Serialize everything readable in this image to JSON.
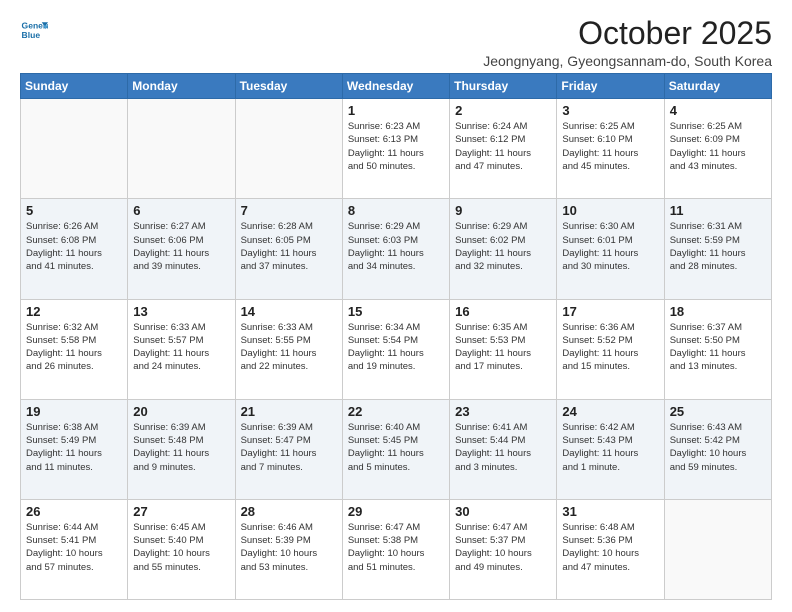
{
  "logo": {
    "line1": "General",
    "line2": "Blue"
  },
  "title": "October 2025",
  "subtitle": "Jeongnyang, Gyeongsannam-do, South Korea",
  "weekdays": [
    "Sunday",
    "Monday",
    "Tuesday",
    "Wednesday",
    "Thursday",
    "Friday",
    "Saturday"
  ],
  "weeks": [
    [
      {
        "day": "",
        "info": ""
      },
      {
        "day": "",
        "info": ""
      },
      {
        "day": "",
        "info": ""
      },
      {
        "day": "1",
        "info": "Sunrise: 6:23 AM\nSunset: 6:13 PM\nDaylight: 11 hours\nand 50 minutes."
      },
      {
        "day": "2",
        "info": "Sunrise: 6:24 AM\nSunset: 6:12 PM\nDaylight: 11 hours\nand 47 minutes."
      },
      {
        "day": "3",
        "info": "Sunrise: 6:25 AM\nSunset: 6:10 PM\nDaylight: 11 hours\nand 45 minutes."
      },
      {
        "day": "4",
        "info": "Sunrise: 6:25 AM\nSunset: 6:09 PM\nDaylight: 11 hours\nand 43 minutes."
      }
    ],
    [
      {
        "day": "5",
        "info": "Sunrise: 6:26 AM\nSunset: 6:08 PM\nDaylight: 11 hours\nand 41 minutes."
      },
      {
        "day": "6",
        "info": "Sunrise: 6:27 AM\nSunset: 6:06 PM\nDaylight: 11 hours\nand 39 minutes."
      },
      {
        "day": "7",
        "info": "Sunrise: 6:28 AM\nSunset: 6:05 PM\nDaylight: 11 hours\nand 37 minutes."
      },
      {
        "day": "8",
        "info": "Sunrise: 6:29 AM\nSunset: 6:03 PM\nDaylight: 11 hours\nand 34 minutes."
      },
      {
        "day": "9",
        "info": "Sunrise: 6:29 AM\nSunset: 6:02 PM\nDaylight: 11 hours\nand 32 minutes."
      },
      {
        "day": "10",
        "info": "Sunrise: 6:30 AM\nSunset: 6:01 PM\nDaylight: 11 hours\nand 30 minutes."
      },
      {
        "day": "11",
        "info": "Sunrise: 6:31 AM\nSunset: 5:59 PM\nDaylight: 11 hours\nand 28 minutes."
      }
    ],
    [
      {
        "day": "12",
        "info": "Sunrise: 6:32 AM\nSunset: 5:58 PM\nDaylight: 11 hours\nand 26 minutes."
      },
      {
        "day": "13",
        "info": "Sunrise: 6:33 AM\nSunset: 5:57 PM\nDaylight: 11 hours\nand 24 minutes."
      },
      {
        "day": "14",
        "info": "Sunrise: 6:33 AM\nSunset: 5:55 PM\nDaylight: 11 hours\nand 22 minutes."
      },
      {
        "day": "15",
        "info": "Sunrise: 6:34 AM\nSunset: 5:54 PM\nDaylight: 11 hours\nand 19 minutes."
      },
      {
        "day": "16",
        "info": "Sunrise: 6:35 AM\nSunset: 5:53 PM\nDaylight: 11 hours\nand 17 minutes."
      },
      {
        "day": "17",
        "info": "Sunrise: 6:36 AM\nSunset: 5:52 PM\nDaylight: 11 hours\nand 15 minutes."
      },
      {
        "day": "18",
        "info": "Sunrise: 6:37 AM\nSunset: 5:50 PM\nDaylight: 11 hours\nand 13 minutes."
      }
    ],
    [
      {
        "day": "19",
        "info": "Sunrise: 6:38 AM\nSunset: 5:49 PM\nDaylight: 11 hours\nand 11 minutes."
      },
      {
        "day": "20",
        "info": "Sunrise: 6:39 AM\nSunset: 5:48 PM\nDaylight: 11 hours\nand 9 minutes."
      },
      {
        "day": "21",
        "info": "Sunrise: 6:39 AM\nSunset: 5:47 PM\nDaylight: 11 hours\nand 7 minutes."
      },
      {
        "day": "22",
        "info": "Sunrise: 6:40 AM\nSunset: 5:45 PM\nDaylight: 11 hours\nand 5 minutes."
      },
      {
        "day": "23",
        "info": "Sunrise: 6:41 AM\nSunset: 5:44 PM\nDaylight: 11 hours\nand 3 minutes."
      },
      {
        "day": "24",
        "info": "Sunrise: 6:42 AM\nSunset: 5:43 PM\nDaylight: 11 hours\nand 1 minute."
      },
      {
        "day": "25",
        "info": "Sunrise: 6:43 AM\nSunset: 5:42 PM\nDaylight: 10 hours\nand 59 minutes."
      }
    ],
    [
      {
        "day": "26",
        "info": "Sunrise: 6:44 AM\nSunset: 5:41 PM\nDaylight: 10 hours\nand 57 minutes."
      },
      {
        "day": "27",
        "info": "Sunrise: 6:45 AM\nSunset: 5:40 PM\nDaylight: 10 hours\nand 55 minutes."
      },
      {
        "day": "28",
        "info": "Sunrise: 6:46 AM\nSunset: 5:39 PM\nDaylight: 10 hours\nand 53 minutes."
      },
      {
        "day": "29",
        "info": "Sunrise: 6:47 AM\nSunset: 5:38 PM\nDaylight: 10 hours\nand 51 minutes."
      },
      {
        "day": "30",
        "info": "Sunrise: 6:47 AM\nSunset: 5:37 PM\nDaylight: 10 hours\nand 49 minutes."
      },
      {
        "day": "31",
        "info": "Sunrise: 6:48 AM\nSunset: 5:36 PM\nDaylight: 10 hours\nand 47 minutes."
      },
      {
        "day": "",
        "info": ""
      }
    ]
  ]
}
